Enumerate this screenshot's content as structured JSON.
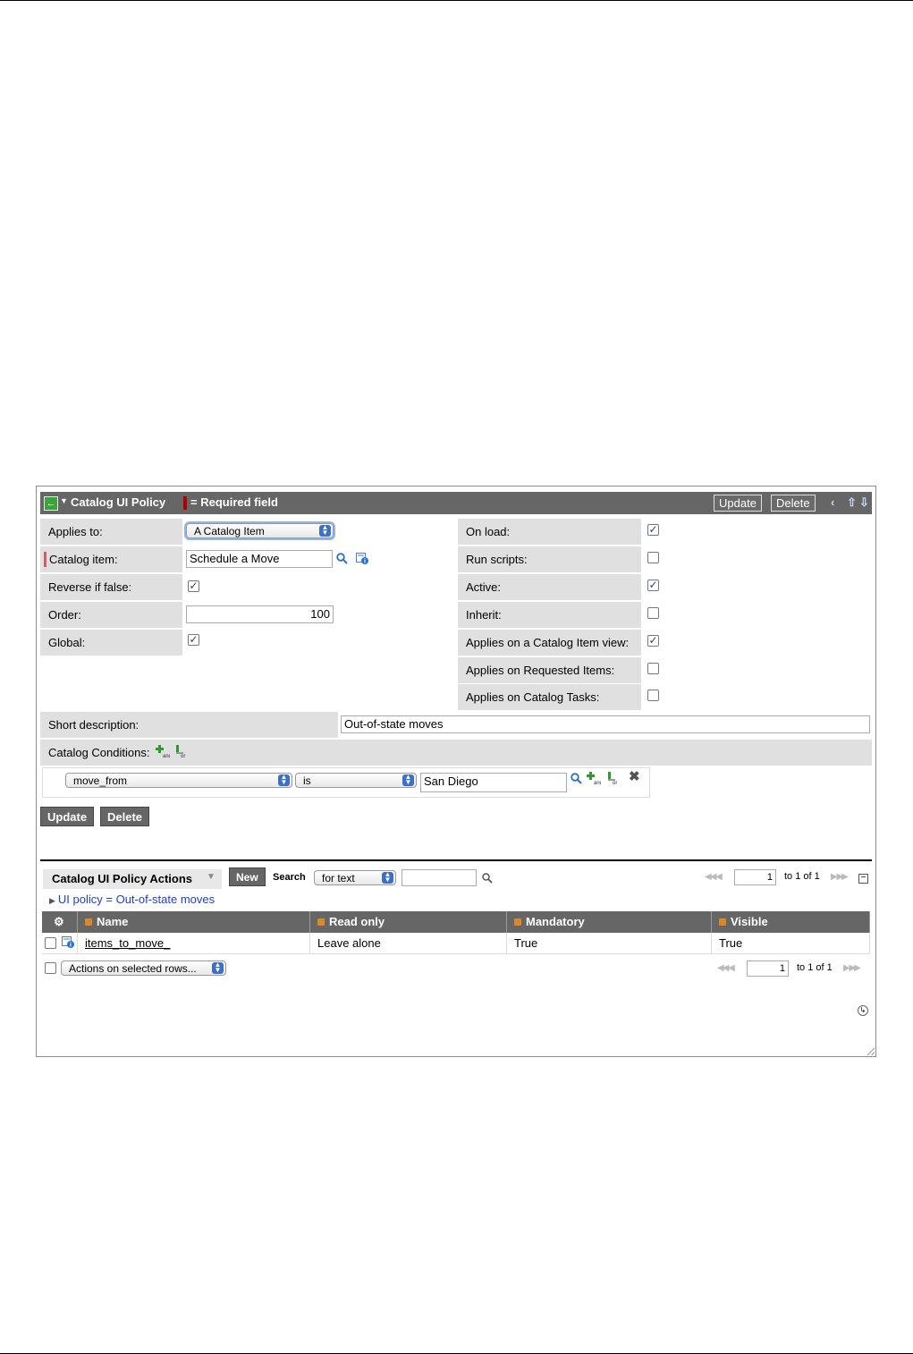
{
  "header": {
    "title": "Catalog UI Policy",
    "required_legend": "= Required field",
    "update_label": "Update",
    "delete_label": "Delete"
  },
  "form": {
    "applies_to": {
      "label": "Applies to:",
      "value": "A Catalog Item"
    },
    "catalog_item": {
      "label": "Catalog item:",
      "value": "Schedule a Move"
    },
    "reverse_if_false": {
      "label": "Reverse if false:",
      "checked": true
    },
    "order": {
      "label": "Order:",
      "value": "100"
    },
    "global": {
      "label": "Global:",
      "checked": true
    },
    "on_load": {
      "label": "On load:",
      "checked": true
    },
    "run_scripts": {
      "label": "Run scripts:",
      "checked": false
    },
    "active": {
      "label": "Active:",
      "checked": true
    },
    "inherit": {
      "label": "Inherit:",
      "checked": false
    },
    "applies_catalog_item_view": {
      "label": "Applies on a Catalog Item view:",
      "checked": true
    },
    "applies_requested_items": {
      "label": "Applies on Requested Items:",
      "checked": false
    },
    "applies_catalog_tasks": {
      "label": "Applies on Catalog Tasks:",
      "checked": false
    },
    "short_description": {
      "label": "Short description:",
      "value": "Out-of-state moves"
    },
    "catalog_conditions": {
      "label": "Catalog Conditions:"
    },
    "condition": {
      "field": "move_from",
      "operator": "is",
      "value": "San Diego"
    },
    "update_label": "Update",
    "delete_label": "Delete"
  },
  "related_list": {
    "title": "Catalog UI Policy Actions",
    "new_label": "New",
    "search_label": "Search",
    "search_select": "for text",
    "search_value": "",
    "page_number": "1",
    "page_total": "to 1 of 1",
    "breadcrumb": "UI policy = Out-of-state moves",
    "columns": [
      "Name",
      "Read only",
      "Mandatory",
      "Visible"
    ],
    "rows": [
      {
        "name": "items_to_move_",
        "read_only": "Leave alone",
        "mandatory": "True",
        "visible": "True"
      }
    ],
    "actions_select": "Actions on selected rows...",
    "footer_page_number": "1",
    "footer_page_total": "to 1 of 1"
  },
  "colors": {
    "header_bar": "#666666",
    "label_bg": "#e0e0e0",
    "required": "#b00000",
    "link": "#1a3fd6"
  }
}
